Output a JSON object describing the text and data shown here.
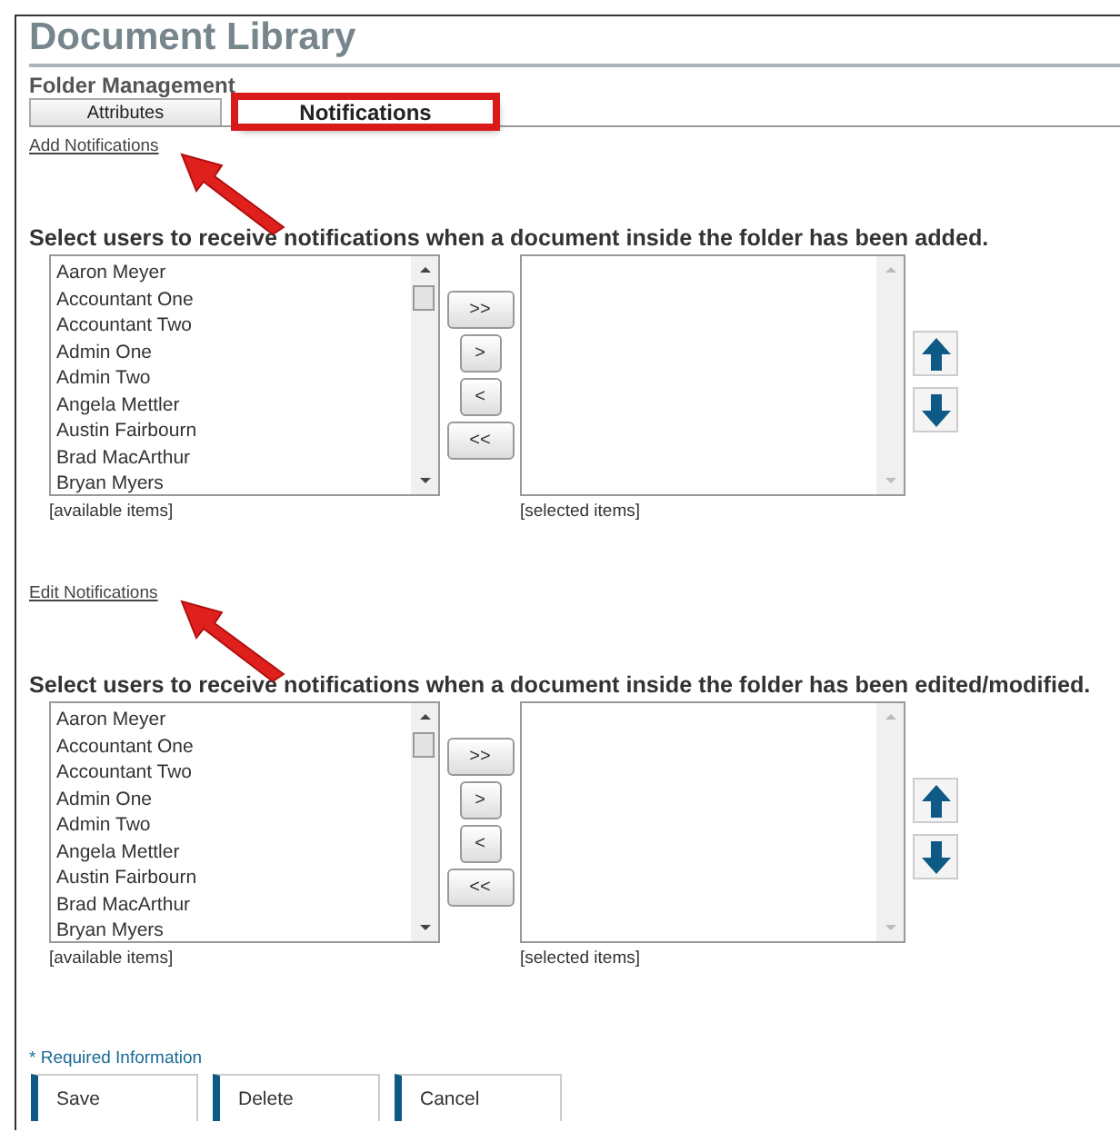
{
  "title": "Document Library",
  "subtitle": "Folder Management",
  "tabs": [
    {
      "label": "Attributes",
      "selected": false,
      "highlighted": false
    },
    {
      "label": "Notifications",
      "selected": true,
      "highlighted": true
    }
  ],
  "sections": [
    {
      "link": "Add Notifications",
      "arrow": true,
      "heading": "Select users to receive notifications when a document inside the folder has been added.",
      "available": [
        "Aaron Meyer",
        "Accountant One",
        "Accountant Two",
        "Admin One",
        "Admin Two",
        "Angela Mettler",
        "Austin Fairbourn",
        "Brad MacArthur",
        "Bryan Myers"
      ],
      "available_label": "[available items]",
      "move_buttons": [
        ">>",
        ">",
        "<",
        "<<"
      ],
      "selected_label": "[selected items]"
    },
    {
      "link": "Edit Notifications",
      "arrow": true,
      "heading": "Select users to receive notifications when a document inside the folder has been edited/modified.",
      "available": [
        "Aaron Meyer",
        "Accountant One",
        "Accountant Two",
        "Admin One",
        "Admin Two",
        "Angela Mettler",
        "Austin Fairbourn",
        "Brad MacArthur",
        "Bryan Myers"
      ],
      "available_label": "[available items]",
      "move_buttons": [
        ">>",
        ">",
        "<",
        "<<"
      ],
      "selected_label": "[selected items]"
    }
  ],
  "required_note": "* Required Information",
  "buttons": [
    "Save",
    "Delete",
    "Cancel"
  ]
}
